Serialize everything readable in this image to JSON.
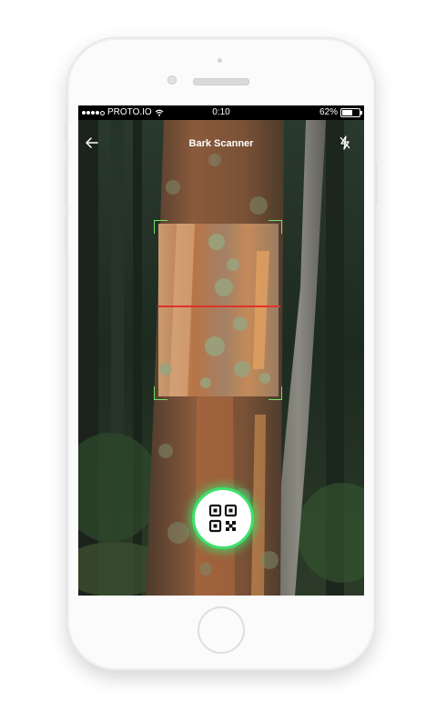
{
  "status_bar": {
    "carrier": "PROTO.IO",
    "time": "0:10",
    "battery_text": "62%",
    "battery_level": 0.62,
    "wifi_icon": "wifi-icon",
    "signal_dots_filled": 4
  },
  "header": {
    "title": "Bark Scanner",
    "back_icon": "back-arrow-icon",
    "flash_icon": "flash-off-icon"
  },
  "scanner": {
    "frame_color": "#6de36a",
    "scan_line_color": "#e0322a"
  },
  "scan_button": {
    "icon": "qr-code-icon",
    "glow_color": "#3ee06c"
  }
}
